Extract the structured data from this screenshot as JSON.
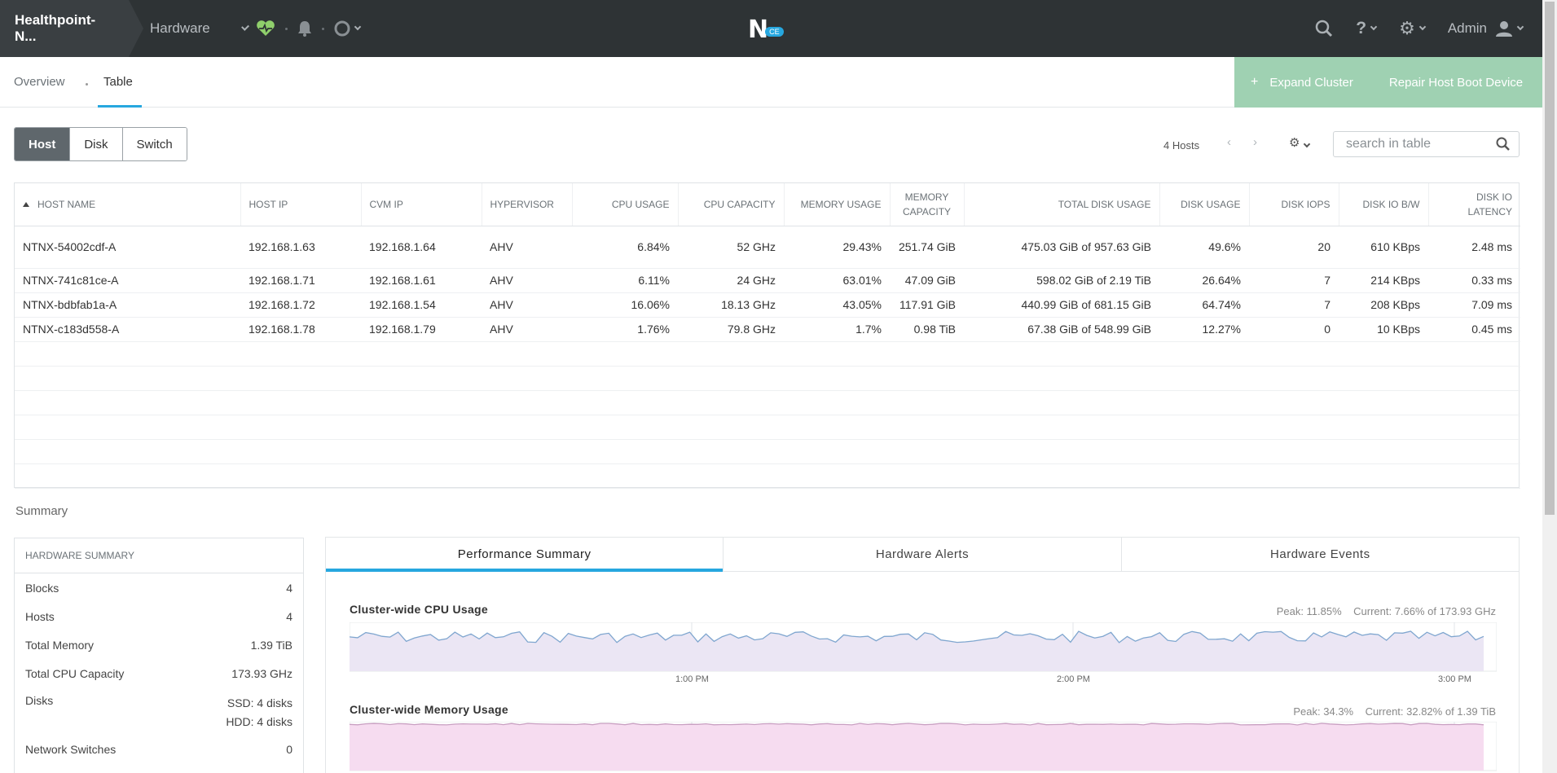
{
  "topbar": {
    "cluster_name": "Healthpoint-N...",
    "nav_label": "Hardware",
    "user_label": "Admin",
    "logo_badge": "CE",
    "accent": "#26a7df"
  },
  "subnav": {
    "tabs": [
      {
        "label": "Overview",
        "active": false
      },
      {
        "label": "Table",
        "active": true
      }
    ],
    "actions": {
      "expand": "Expand Cluster",
      "repair": "Repair Host Boot Device"
    }
  },
  "entity_toggle": [
    "Host",
    "Disk",
    "Switch"
  ],
  "table_controls": {
    "count": "4 Hosts",
    "search_placeholder": "search in table"
  },
  "table": {
    "columns": [
      "HOST NAME",
      "HOST IP",
      "CVM IP",
      "HYPERVISOR",
      "CPU USAGE",
      "CPU CAPACITY",
      "MEMORY USAGE",
      "MEMORY CAPACITY",
      "TOTAL DISK USAGE",
      "DISK USAGE",
      "DISK IOPS",
      "DISK IO B/W",
      "DISK IO LATENCY"
    ],
    "rows": [
      [
        "NTNX-54002cdf-A",
        "192.168.1.63",
        "192.168.1.64",
        "AHV",
        "6.84%",
        "52 GHz",
        "29.43%",
        "251.74 GiB",
        "475.03 GiB of 957.63 GiB",
        "49.6%",
        "20",
        "610 KBps",
        "2.48 ms"
      ],
      [
        "NTNX-741c81ce-A",
        "192.168.1.71",
        "192.168.1.61",
        "AHV",
        "6.11%",
        "24 GHz",
        "63.01%",
        "47.09 GiB",
        "598.02 GiB of 2.19 TiB",
        "26.64%",
        "7",
        "214 KBps",
        "0.33 ms"
      ],
      [
        "NTNX-bdbfab1a-A",
        "192.168.1.72",
        "192.168.1.54",
        "AHV",
        "16.06%",
        "18.13 GHz",
        "43.05%",
        "117.91 GiB",
        "440.99 GiB of 681.15 GiB",
        "64.74%",
        "7",
        "208 KBps",
        "7.09 ms"
      ],
      [
        "NTNX-c183d558-A",
        "192.168.1.78",
        "192.168.1.79",
        "AHV",
        "1.76%",
        "79.8 GHz",
        "1.7%",
        "0.98 TiB",
        "67.38 GiB of 548.99 GiB",
        "12.27%",
        "0",
        "10 KBps",
        "0.45 ms"
      ]
    ]
  },
  "summary": {
    "label": "Summary",
    "hardware": {
      "title": "HARDWARE SUMMARY",
      "blocks_label": "Blocks",
      "blocks": "4",
      "hosts_label": "Hosts",
      "hosts": "4",
      "memory_label": "Total Memory",
      "memory": "1.39 TiB",
      "cpu_label": "Total CPU Capacity",
      "cpu": "173.93 GHz",
      "disks_label": "Disks",
      "ssd": "SSD: 4 disks",
      "hdd": "HDD: 4 disks",
      "switches_label": "Network Switches",
      "switches": "0"
    },
    "tabs": [
      "Performance Summary",
      "Hardware Alerts",
      "Hardware Events"
    ],
    "cpu_chart": {
      "title": "Cluster-wide CPU Usage",
      "peak": "Peak: 11.85%",
      "current": "Current: 7.66% of 173.93 GHz"
    },
    "mem_chart": {
      "title": "Cluster-wide Memory Usage",
      "peak": "Peak: 34.3%",
      "current": "Current: 32.82% of 1.39 TiB"
    },
    "x_ticks": [
      "1:00 PM",
      "2:00 PM",
      "3:00 PM"
    ]
  }
}
